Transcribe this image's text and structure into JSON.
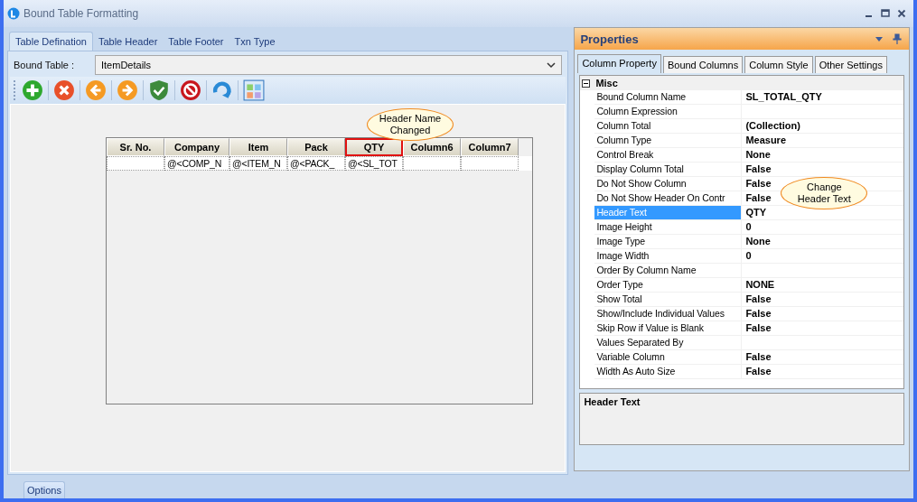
{
  "window": {
    "title": "Bound Table Formatting"
  },
  "tabs": [
    {
      "label": "Table Defination",
      "selected": true
    },
    {
      "label": "Table Header",
      "selected": false
    },
    {
      "label": "Table Footer",
      "selected": false
    },
    {
      "label": "Txn Type",
      "selected": false
    }
  ],
  "bound_table": {
    "label": "Bound Table :",
    "value": "ItemDetails"
  },
  "table": {
    "columns": [
      {
        "label": "Sr. No.",
        "highlighted": false
      },
      {
        "label": "Company",
        "highlighted": false,
        "cell": "@<COMP_N"
      },
      {
        "label": "Item",
        "highlighted": false,
        "cell": "@<ITEM_N"
      },
      {
        "label": "Pack",
        "highlighted": false,
        "cell": "@<PACK_"
      },
      {
        "label": "QTY",
        "highlighted": true,
        "cell": "@<SL_TOT"
      },
      {
        "label": "Column6",
        "highlighted": false
      },
      {
        "label": "Column7",
        "highlighted": false
      }
    ]
  },
  "callouts": [
    {
      "text": "Header Name Changed"
    },
    {
      "text": "Change Header Text"
    }
  ],
  "properties": {
    "title": "Properties",
    "tabs": [
      {
        "label": "Column Property",
        "selected": true
      },
      {
        "label": "Bound Columns",
        "selected": false
      },
      {
        "label": "Column Style",
        "selected": false
      },
      {
        "label": "Other Settings",
        "selected": false
      }
    ],
    "category": {
      "label": "Misc",
      "expanded": true
    },
    "rows": [
      {
        "name": "Bound Column Name",
        "value": "SL_TOTAL_QTY",
        "selected": false
      },
      {
        "name": "Column Expression",
        "selected": false
      },
      {
        "name": "Column Total",
        "value": "(Collection)",
        "selected": false
      },
      {
        "name": "Column Type",
        "value": "Measure",
        "selected": false
      },
      {
        "name": "Control Break",
        "value": "None",
        "selected": false
      },
      {
        "name": "Display Column Total",
        "value": "False",
        "selected": false
      },
      {
        "name": "Do Not Show Column",
        "value": "False",
        "selected": false
      },
      {
        "name": "Do Not Show Header On Contr",
        "value": "False",
        "selected": false
      },
      {
        "name": "Header Text",
        "value": "QTY",
        "selected": true
      },
      {
        "name": "Image Height",
        "value": "0",
        "selected": false
      },
      {
        "name": "Image Type",
        "value": "None",
        "selected": false
      },
      {
        "name": "Image Width",
        "value": "0",
        "selected": false
      },
      {
        "name": "Order By Column Name",
        "selected": false
      },
      {
        "name": "Order Type",
        "value": "NONE",
        "selected": false
      },
      {
        "name": "Show Total",
        "value": "False",
        "selected": false
      },
      {
        "name": "Show/Include Individual Values",
        "value": "False",
        "selected": false
      },
      {
        "name": "Skip Row if Value is Blank",
        "value": "False",
        "selected": false
      },
      {
        "name": "Values Separated By",
        "selected": false
      },
      {
        "name": "Variable Column",
        "value": "False",
        "selected": false
      },
      {
        "name": "Width As Auto Size",
        "value": "False",
        "selected": false
      }
    ],
    "description": "Header Text"
  },
  "bottom_tab": {
    "label": "Options"
  }
}
